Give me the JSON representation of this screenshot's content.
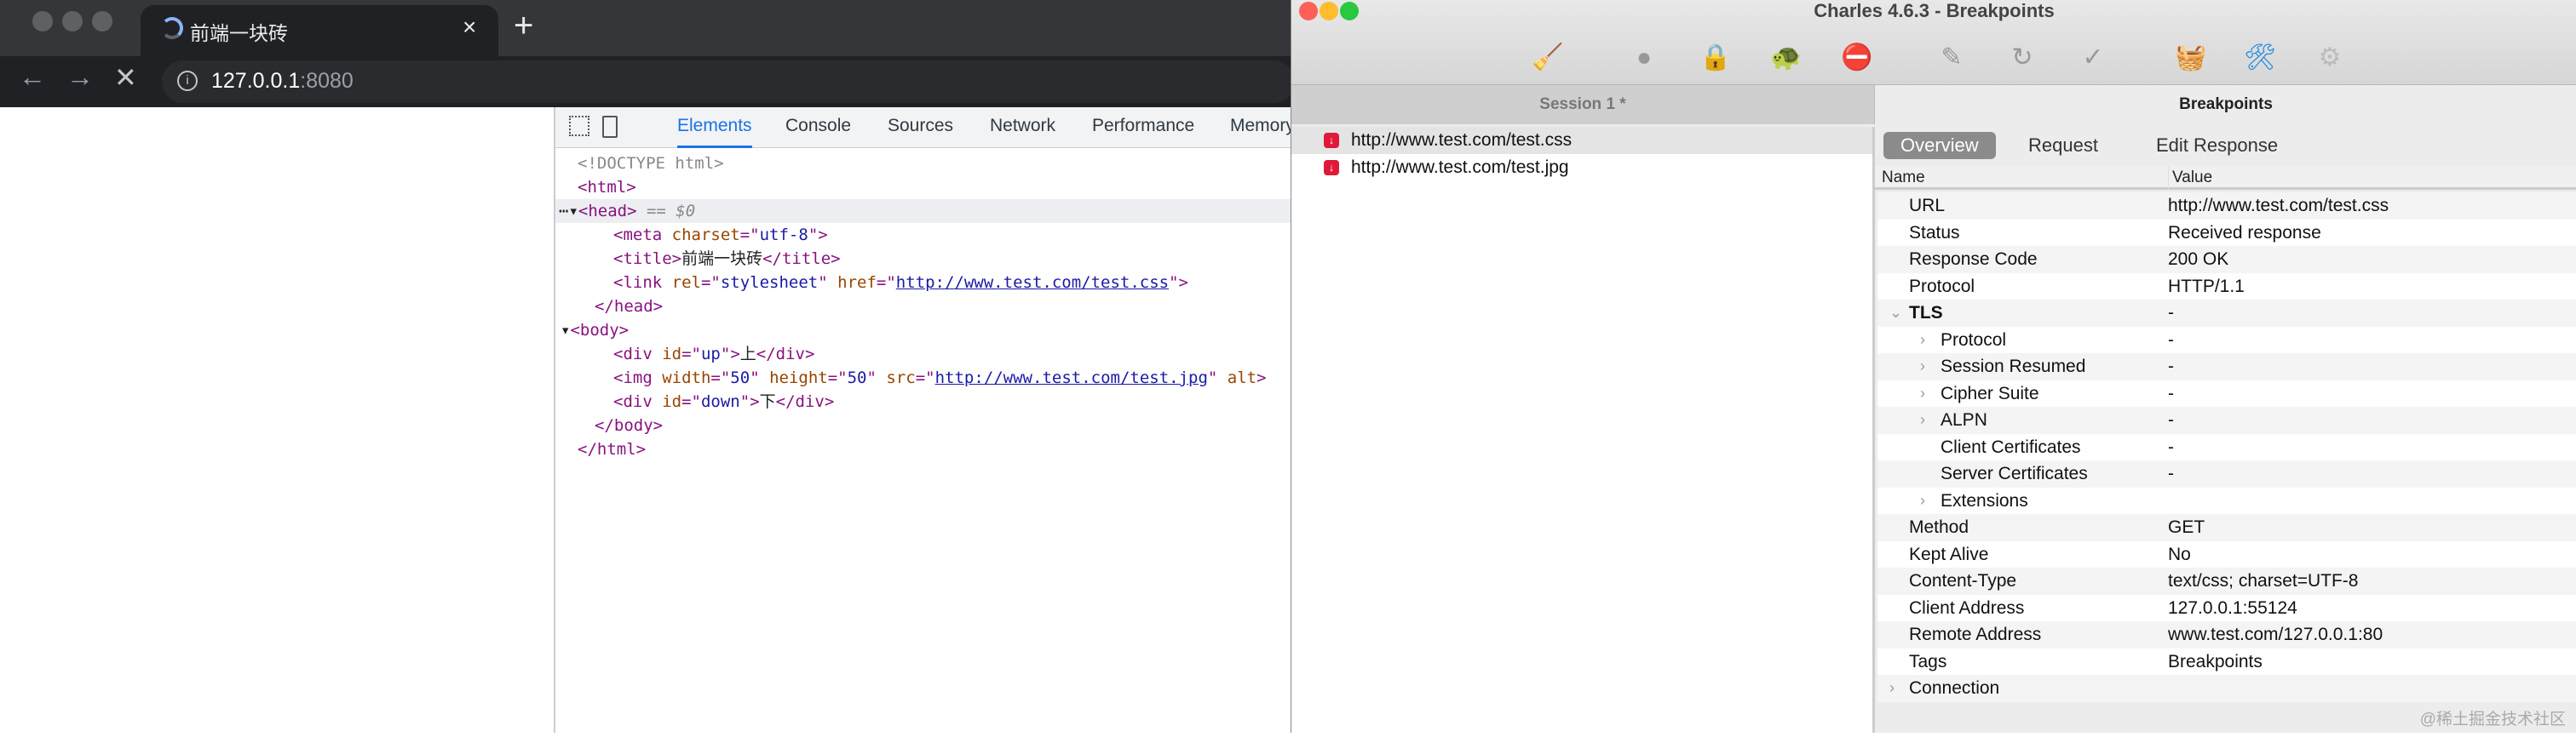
{
  "browser": {
    "tab_title": "前端一块砖",
    "url_host": "127.0.0.1",
    "url_port": ":8080"
  },
  "devtools": {
    "tabs": [
      "Elements",
      "Console",
      "Sources",
      "Network",
      "Performance",
      "Memory"
    ],
    "dom": {
      "doctype": "<!DOCTYPE html>",
      "html_open": "<html>",
      "head_open": "<head>",
      "head_marker": " == $0",
      "meta": [
        "<meta ",
        "charset",
        "=\"",
        "utf-8",
        "\">"
      ],
      "title_open": "<title>",
      "title_text": "前端一块砖",
      "title_close": "</title>",
      "link": [
        "<link ",
        "rel",
        "=\"",
        "stylesheet",
        "\" ",
        "href",
        "=\"",
        "http://www.test.com/test.css",
        "\">"
      ],
      "head_close": "</head>",
      "body_open": "<body>",
      "div_up": [
        "<div ",
        "id",
        "=\"",
        "up",
        "\">",
        "上",
        "</div>"
      ],
      "img": [
        "<img ",
        "width",
        "=\"",
        "50",
        "\" ",
        "height",
        "=\"",
        "50",
        "\" ",
        "src",
        "=\"",
        "http://www.test.com/test.jpg",
        "\" ",
        "alt",
        ">"
      ],
      "div_down": [
        "<div ",
        "id",
        "=\"",
        "down",
        "\">",
        "下",
        "</div>"
      ],
      "body_close": "</body>",
      "html_close": "</html>"
    }
  },
  "charles": {
    "title": "Charles 4.6.3 - Breakpoints",
    "tabs": {
      "session": "Session 1 *",
      "breakpoints": "Breakpoints"
    },
    "requests": [
      "http://www.test.com/test.css",
      "http://www.test.com/test.jpg"
    ],
    "detail_tabs": [
      "Overview",
      "Request",
      "Edit Response"
    ],
    "columns": {
      "name": "Name",
      "value": "Value"
    },
    "rows": [
      {
        "name": "URL",
        "value": "http://www.test.com/test.css"
      },
      {
        "name": "Status",
        "value": "Received response"
      },
      {
        "name": "Response Code",
        "value": "200 OK"
      },
      {
        "name": "Protocol",
        "value": "HTTP/1.1"
      },
      {
        "name": "TLS",
        "value": "-"
      },
      {
        "name": "Protocol",
        "value": "-"
      },
      {
        "name": "Session Resumed",
        "value": "-"
      },
      {
        "name": "Cipher Suite",
        "value": "-"
      },
      {
        "name": "ALPN",
        "value": "-"
      },
      {
        "name": "Client Certificates",
        "value": "-"
      },
      {
        "name": "Server Certificates",
        "value": "-"
      },
      {
        "name": "Extensions",
        "value": ""
      },
      {
        "name": "Method",
        "value": "GET"
      },
      {
        "name": "Kept Alive",
        "value": "No"
      },
      {
        "name": "Content-Type",
        "value": "text/css; charset=UTF-8"
      },
      {
        "name": "Client Address",
        "value": "127.0.0.1:55124"
      },
      {
        "name": "Remote Address",
        "value": "www.test.com/127.0.0.1:80"
      },
      {
        "name": "Tags",
        "value": "Breakpoints"
      },
      {
        "name": "Connection",
        "value": ""
      }
    ]
  },
  "watermark": "@稀土掘金技术社区"
}
